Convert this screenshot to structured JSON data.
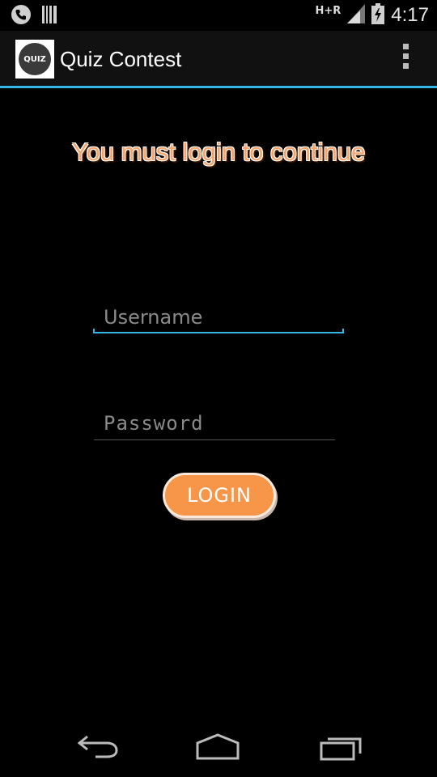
{
  "status_bar": {
    "network_label": "H+R",
    "time": "4:17",
    "icons": [
      "phone-icon",
      "barcode-icon",
      "signal-icon",
      "battery-charging-icon"
    ]
  },
  "action_bar": {
    "logo_text": "QUIZ",
    "title": "Quiz Contest",
    "overflow_icon": "overflow-menu-icon"
  },
  "main": {
    "headline": "You must login to continue",
    "username_placeholder": "Username",
    "password_placeholder": "Password",
    "login_label": "LOGIN"
  },
  "nav_bar": {
    "icons": [
      "back-icon",
      "home-icon",
      "recents-icon"
    ]
  },
  "colors": {
    "accent": "#33b5e5",
    "headline": "#f7a36b",
    "button": "#f79548",
    "background": "#000000",
    "action_bar": "#111111"
  }
}
